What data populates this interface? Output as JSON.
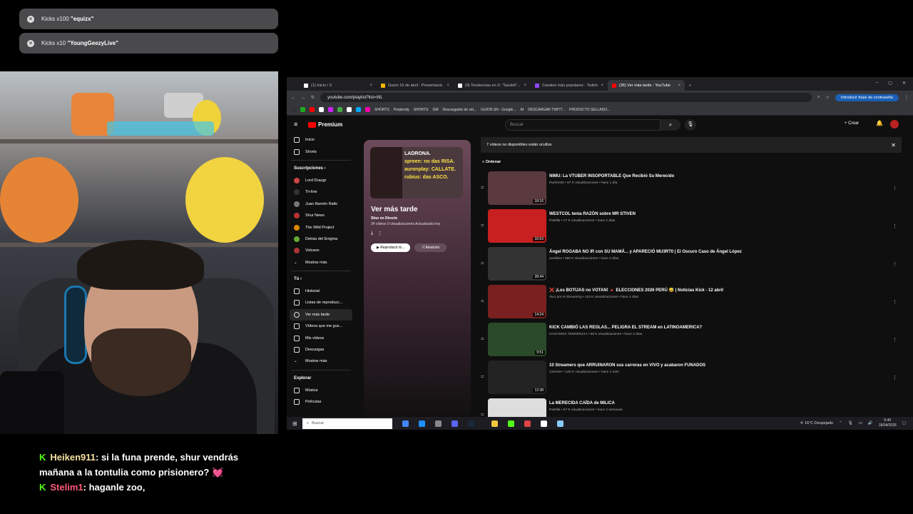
{
  "notifications": [
    {
      "prefix": "Kicks x100 ",
      "user": "\"equizx\""
    },
    {
      "prefix": "Kicks x10 ",
      "user": "\"YoungGeezyLive\""
    }
  ],
  "chat": [
    {
      "user": "Heiken911",
      "message": ": si la funa prende, shur vendrás mañana a la tontulia como prisionero? 💓"
    },
    {
      "user": "Stelim1",
      "message": ": haganle zoo,"
    }
  ],
  "browser": {
    "tabs": [
      {
        "title": "(1) Inicio / X"
      },
      {
        "title": "Guion 16 de abril - Presentació..."
      },
      {
        "title": "(9) Tendencias en X: \"Saulett\"..."
      },
      {
        "title": "Canales más populares - Twitch"
      },
      {
        "title": "(36) Ver más tarde - YouTube"
      }
    ],
    "url": "youtube.com/playlist?list=WL",
    "password_hint": "Introducir frase de contraseña",
    "bookmarks": [
      "SHORTS",
      "Perplexity",
      "SHORTS",
      "GM",
      "Descargador de vid...",
      "GUION SN - Google...",
      "AI",
      "DESCARGAR TWITT...",
      "PRODUCTO SELLADO..."
    ]
  },
  "youtube": {
    "logo": "Premium",
    "search_placeholder": "Buscar",
    "create_label": "Crear",
    "sidebar": {
      "main": [
        {
          "label": "Inicio"
        },
        {
          "label": "Shorts"
        }
      ],
      "subs_header": "Suscripciones",
      "subs": [
        {
          "label": "Lord Draugr",
          "color": "#c44"
        },
        {
          "label": "Tri-line",
          "color": "#333"
        },
        {
          "label": "Juan Ramón Rallo",
          "color": "#777"
        },
        {
          "label": "Shur News",
          "color": "#b33"
        },
        {
          "label": "The Wild Project",
          "color": "#d80"
        },
        {
          "label": "Detrás del Enigma",
          "color": "#6a3"
        },
        {
          "label": "Volcano",
          "color": "#a33"
        },
        {
          "label": "Mostrar más",
          "color": "none"
        }
      ],
      "you_header": "Tú",
      "you": [
        {
          "label": "Historial"
        },
        {
          "label": "Listas de reproducc..."
        },
        {
          "label": "Ver más tarde"
        },
        {
          "label": "Vídeos que me gus..."
        },
        {
          "label": "Mis vídeos"
        },
        {
          "label": "Descargas"
        },
        {
          "label": "Mostrar más"
        }
      ],
      "explore_header": "Explorar",
      "explore": [
        {
          "label": "Música"
        },
        {
          "label": "Películas"
        }
      ]
    },
    "playlist": {
      "thumb_lines": [
        "LADRONA.",
        "spreen: no das RISA.",
        "auronplay: CALLATE.",
        "rubius: das ASCO."
      ],
      "title": "Ver más tarde",
      "owner": "Shur en Directo",
      "meta": "34 vídeos   0 visualizaciones   Actualizada hoy",
      "play_label": "Reproducir to...",
      "shuffle_label": "Aleatorio"
    },
    "hidden_banner": "7 vídeos no disponibles están ocultos",
    "sort_label": "Ordenar",
    "videos": [
      {
        "title": "NIMU: La VTUBER INSOPORTABLE Que Recibió Su Merecido",
        "sub": "Ruehm92 • 67 K visualizaciones • hace 1 día",
        "duration": "18:16",
        "thumb": "#5a3a3e"
      },
      {
        "title": "WESTCOL tenía RAZÓN sobre MR STIVEN",
        "sub": "Pastilla • 17 K visualizaciones • hace 2 días",
        "duration": "16:53",
        "thumb": "#c82020"
      },
      {
        "title": "Ángel ROGABA NO IR con SU MAMÁ... y APARECIÓ MU3RT0 | El Oscuro Caso de Ángel López",
        "sub": "avelidex • 660 K visualizaciones • hace 3 días",
        "duration": "28:44",
        "thumb": "#333"
      },
      {
        "title": "❌ ¡Los BOTIJAS no VOTAN! 🔺 ELECCIONES 2026 PERÚ 😅 | Noticias Kick - 12 abril",
        "sub": "Vivo por el Streaming • 115 K visualizaciones • hace 4 días",
        "duration": "14:24",
        "thumb": "#7a2020"
      },
      {
        "title": "KICK CAMBIÓ LAS REGLAS... PELIGRA EL STREAM en LATINOAMERICA?",
        "sub": "HAGAMOS TENDENCIA • 58 K visualizaciones • hace 3 días",
        "duration": "9:51",
        "thumb": "#2a4a2a"
      },
      {
        "title": "10 Streamers que ARRUINARON sus carreras en VIVO y acabaron FUNADOS",
        "sub": "Cinemer • 125 K visualizaciones • hace 1 mes",
        "duration": "12:38",
        "thumb": "#222"
      },
      {
        "title": "La MERECIDA CAÍDA de MILICA",
        "sub": "Pastilla • 57 K visualizaciones • hace 2 semanas",
        "duration": "",
        "thumb": "#ddd"
      }
    ]
  },
  "taskbar": {
    "search": "Buscar",
    "weather": "16°C  Despejado",
    "time": "0:40",
    "date": "18/04/2026"
  }
}
